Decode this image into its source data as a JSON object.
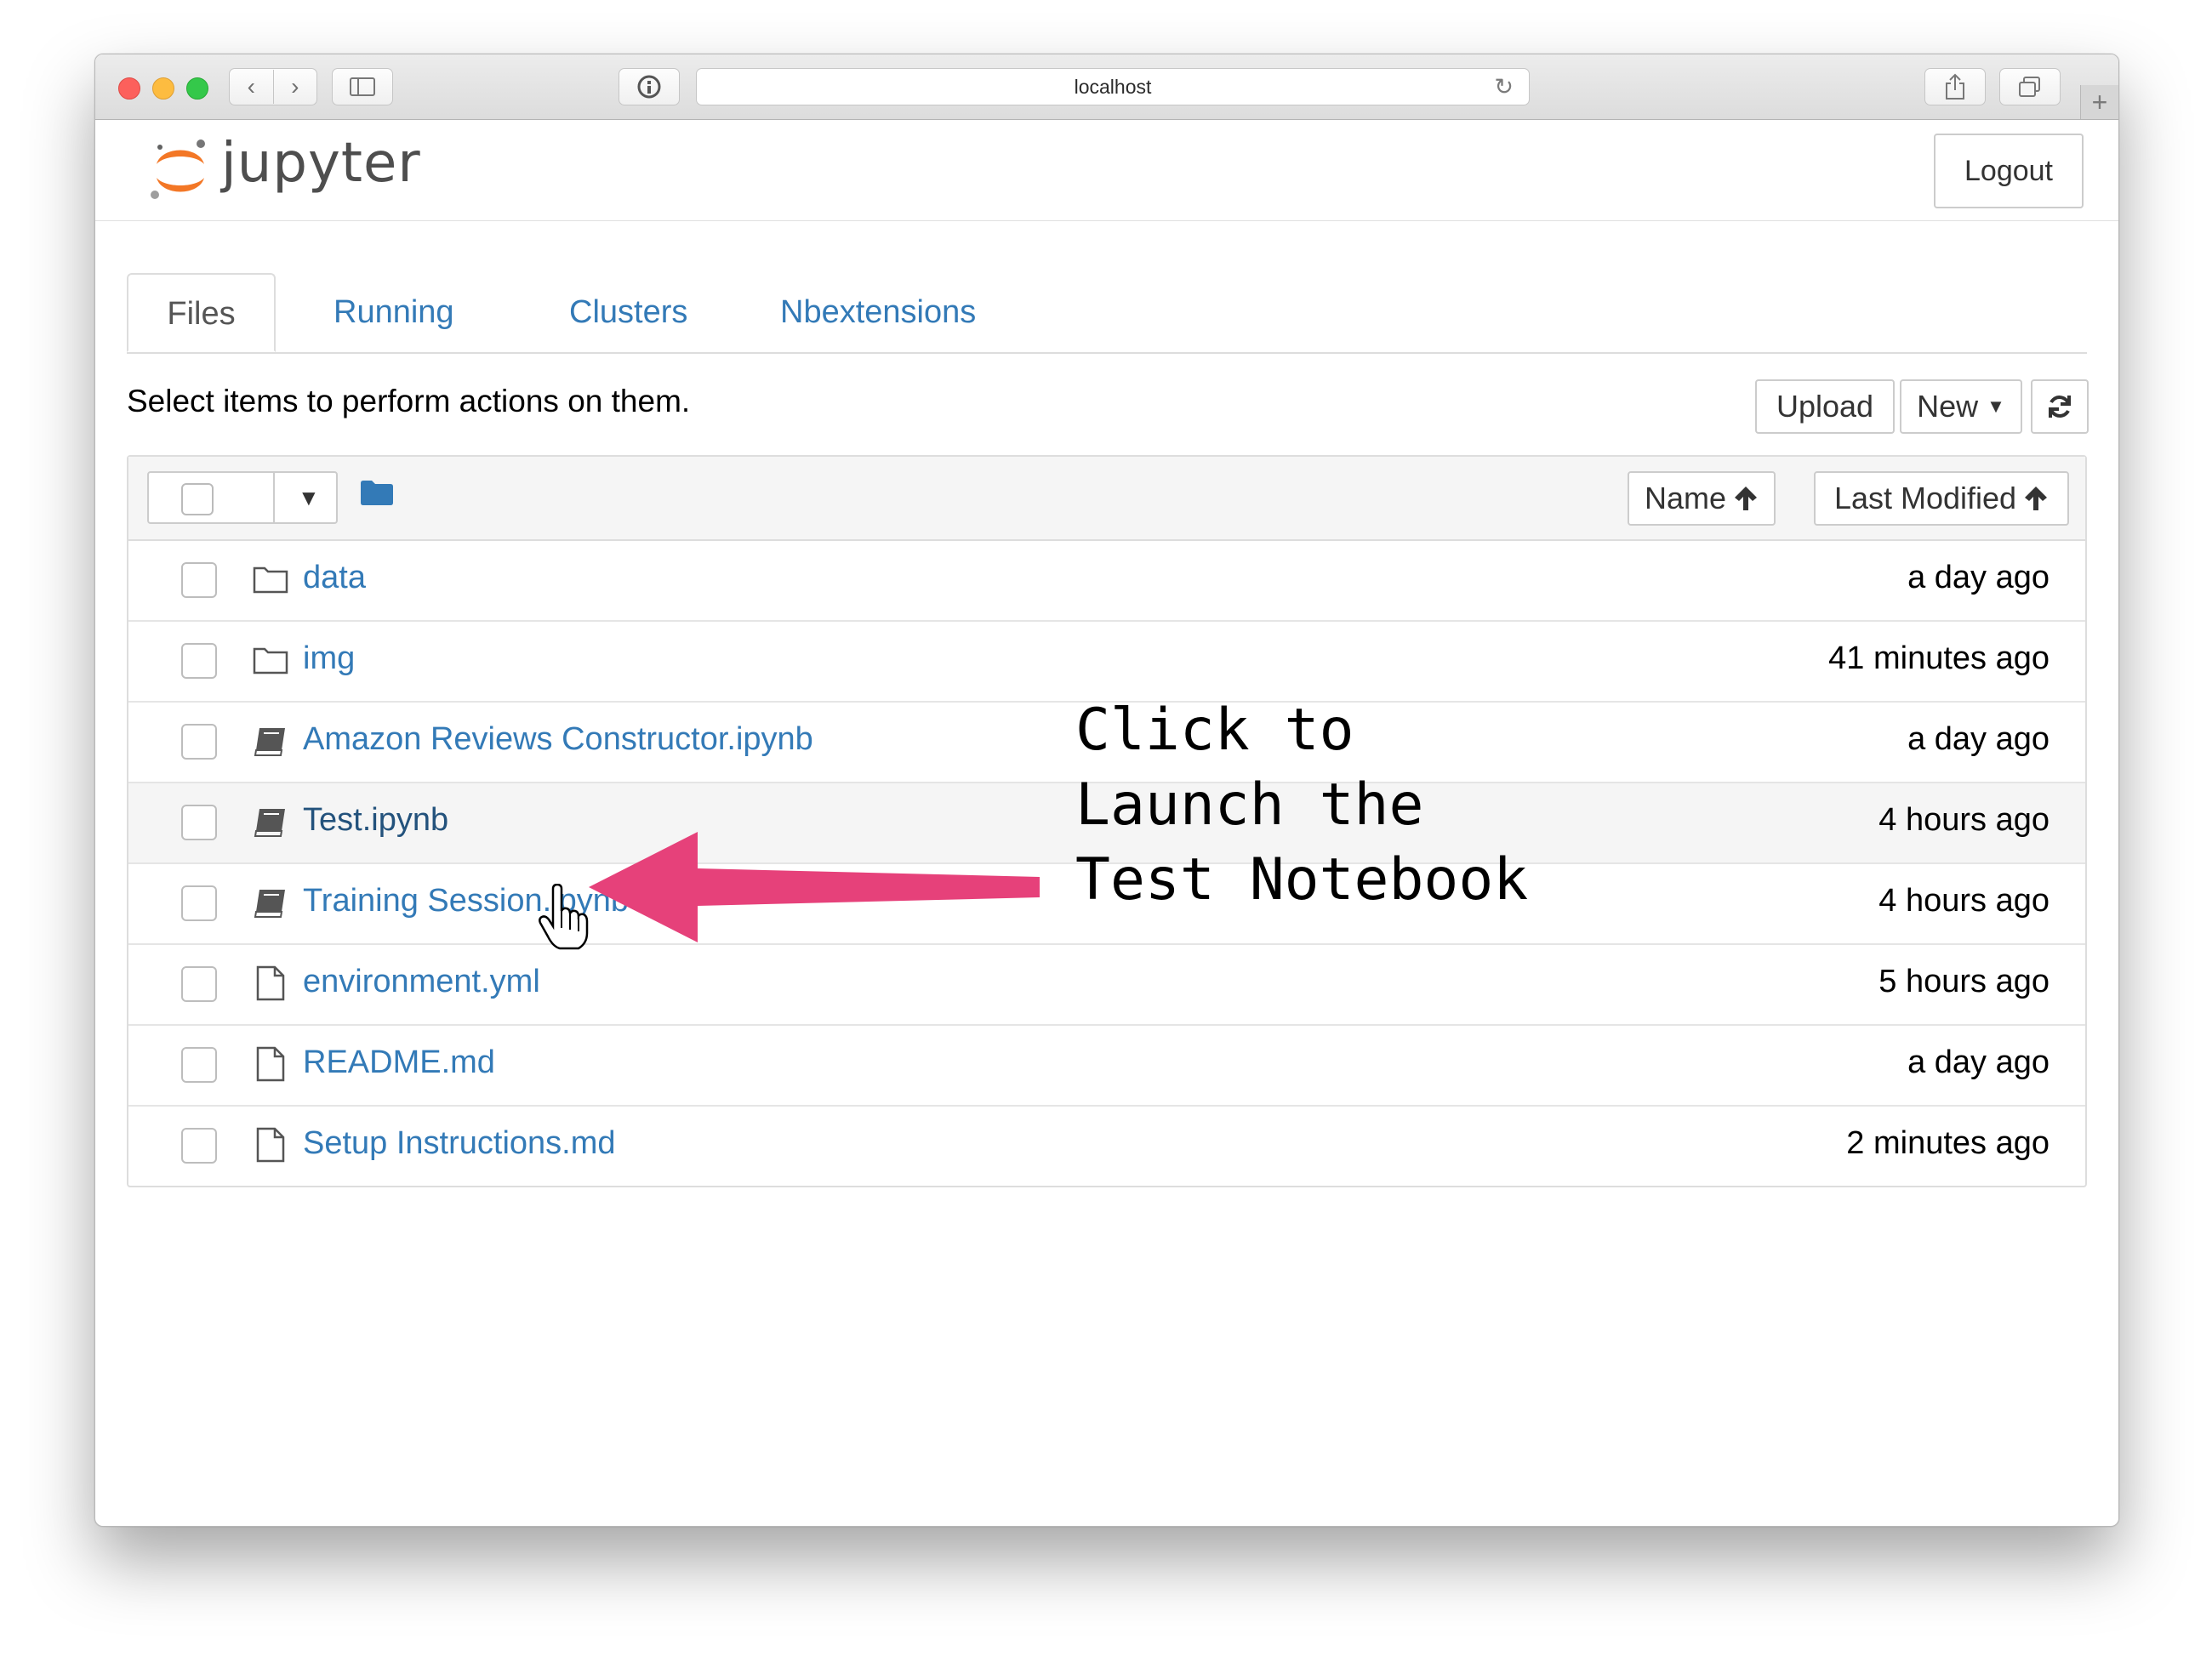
{
  "browser": {
    "url": "localhost"
  },
  "header": {
    "logo_text": "jupyter",
    "logout_label": "Logout"
  },
  "tabs": [
    {
      "label": "Files",
      "active": true
    },
    {
      "label": "Running",
      "active": false
    },
    {
      "label": "Clusters",
      "active": false
    },
    {
      "label": "Nbextensions",
      "active": false
    }
  ],
  "toolbar": {
    "hint": "Select items to perform actions on them.",
    "upload_label": "Upload",
    "new_label": "New"
  },
  "list_header": {
    "sort_name_label": "Name",
    "sort_modified_label": "Last Modified"
  },
  "files": [
    {
      "name": "data",
      "type": "folder",
      "modified": "a day ago"
    },
    {
      "name": "img",
      "type": "folder",
      "modified": "41 minutes ago"
    },
    {
      "name": "Amazon Reviews Constructor.ipynb",
      "type": "notebook",
      "modified": "a day ago"
    },
    {
      "name": "Test.ipynb",
      "type": "notebook",
      "modified": "4 hours ago"
    },
    {
      "name": "Training Session.ipynb",
      "type": "notebook",
      "modified": "4 hours ago"
    },
    {
      "name": "environment.yml",
      "type": "file",
      "modified": "5 hours ago"
    },
    {
      "name": "README.md",
      "type": "file",
      "modified": "a day ago"
    },
    {
      "name": "Setup Instructions.md",
      "type": "file",
      "modified": "2 minutes ago"
    }
  ],
  "annotation": {
    "line1": "Click to",
    "line2": "Launch the",
    "line3": "Test Notebook"
  },
  "colors": {
    "link": "#337ab7",
    "arrow": "#e6417a",
    "logo_orange": "#f37726"
  }
}
